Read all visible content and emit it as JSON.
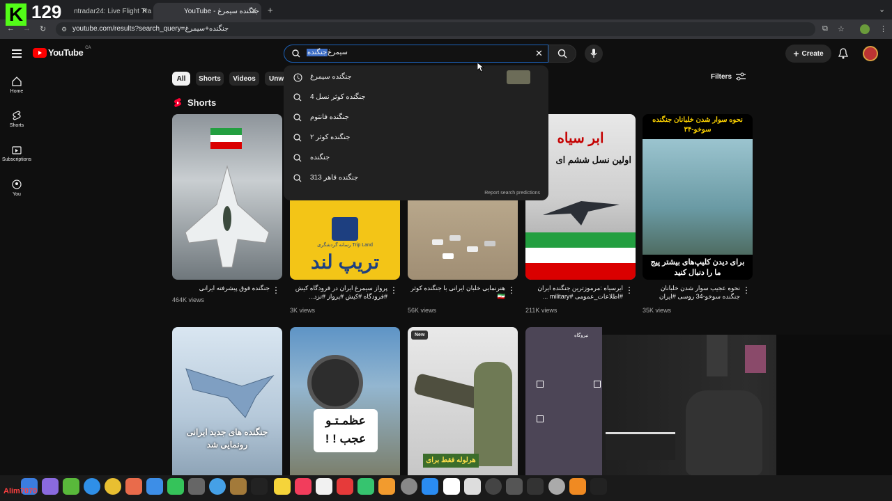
{
  "overlay": {
    "viewer_count": "129",
    "streamer_name": "Alim7070"
  },
  "browser": {
    "tabs": [
      {
        "title": "ntradar24: Live Flight Tra"
      },
      {
        "title": "YouTube - جنگنده سیمرغ"
      }
    ],
    "url": "youtube.com/results?search_query=جنگنده+سیمرغ"
  },
  "youtube": {
    "logo_text": "YouTube",
    "region": "CA",
    "search_value_plain": "سیمرغ ",
    "search_value_selected": "جنگنده",
    "create_label": "Create",
    "filters_label": "Filters",
    "sidebar": [
      {
        "label": "Home",
        "icon": "home-icon"
      },
      {
        "label": "Shorts",
        "icon": "shorts-icon"
      },
      {
        "label": "Subscriptions",
        "icon": "subscriptions-icon"
      },
      {
        "label": "You",
        "icon": "you-icon"
      }
    ],
    "chips": [
      "All",
      "Shorts",
      "Videos",
      "Unw"
    ],
    "shorts_heading": "Shorts",
    "suggestions": [
      {
        "text": "جنگنده سیمرغ",
        "icon": "history-icon"
      },
      {
        "text": "جنگنده کوثر نسل 4",
        "icon": "search-icon"
      },
      {
        "text": "جنگنده فانتوم",
        "icon": "search-icon"
      },
      {
        "text": "جنگنده کوثر ۲",
        "icon": "search-icon"
      },
      {
        "text": "جنگنده",
        "icon": "search-icon"
      },
      {
        "text": "جنگنده قاهر 313",
        "icon": "search-icon"
      }
    ],
    "report_predictions": "Report search predictions",
    "cards": [
      {
        "title": "جنگنده فوق پیشرفته ایرانی",
        "views": "464K views"
      },
      {
        "title": "پرواز سیمرغ ایران در فرودگاه کیش #فرودگاه #کیش #پرواز #تزد...",
        "views": "3K views",
        "thumb_text": "تریپ لند",
        "thumb_sub": "رسانه گردشگری Trip Land"
      },
      {
        "title": "هنرنمایی خلبان ایرانی با جنگنده کوثر 🇮🇷",
        "views": "56K views"
      },
      {
        "title": "ایرسیاه :مرموزترین جنگنده ایران #اطلاعات_عمومی #military ...",
        "views": "211K views",
        "thumb_text": "ابر سیاه",
        "thumb_sub": "اولین نسل ششم ای"
      },
      {
        "title": "نحوه عجیب سوار شدن خلبانان جنگنده سوخو-34 روسی #ایران #milita...",
        "views": "35K views",
        "thumb_text": "نحوه سوار شدن خلبانان جنگنده سوخو-۳۴",
        "thumb_sub": "برای دیدن کلیپ‌های بیشتر پیج ما را دنبال کنید"
      }
    ],
    "row2": [
      {
        "thumb_text": "جنگنده های جدید ایرانی رونمایی شد"
      },
      {
        "thumb_text": "عظمـتـو عجب ! !"
      },
      {
        "badge": "New",
        "thumb_text": "هرلوله فقط برای"
      },
      {
        "thumb_text": "نیروگاه"
      }
    ]
  }
}
